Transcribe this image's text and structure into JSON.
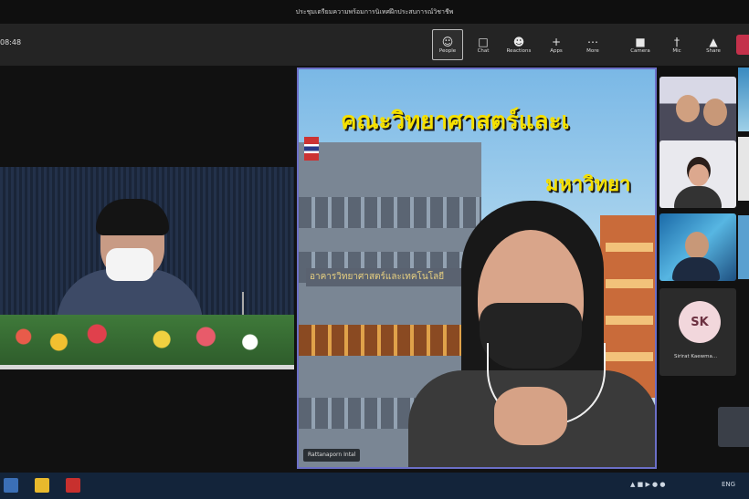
{
  "window": {
    "title": "ประชุมเตรียมความพร้อมการนิเทศฝึกประสบการณ์วิชาชีพ"
  },
  "toolbar": {
    "timer": "08:48",
    "buttons": [
      {
        "label": "People",
        "icon": "people-icon"
      },
      {
        "label": "Chat",
        "icon": "chat-icon"
      },
      {
        "label": "Reactions",
        "icon": "reactions-icon"
      },
      {
        "label": "Apps",
        "icon": "apps-icon"
      },
      {
        "label": "More",
        "icon": "more-icon"
      },
      {
        "label": "Camera",
        "icon": "camera-icon"
      },
      {
        "label": "Mic",
        "icon": "mic-icon"
      },
      {
        "label": "Share",
        "icon": "share-icon"
      }
    ]
  },
  "main_video": {
    "slide_title": "คณะวิทยาศาสตร์และเ",
    "slide_subtitle": "มหาวิทยา",
    "banner_text": "อาคารวิทยาศาสตร์และเทคโนโลยี",
    "participant_name": "Rattanaporn Intal"
  },
  "participants": {
    "avatar_initials": "SK",
    "avatar_name": "Sirirat Kaewma..."
  },
  "taskbar": {
    "tray_time": "ENG"
  },
  "colors": {
    "active_speaker_border": "#6b6fc7",
    "leave_button": "#c4314b",
    "slide_title_yellow": "#f5e000"
  }
}
